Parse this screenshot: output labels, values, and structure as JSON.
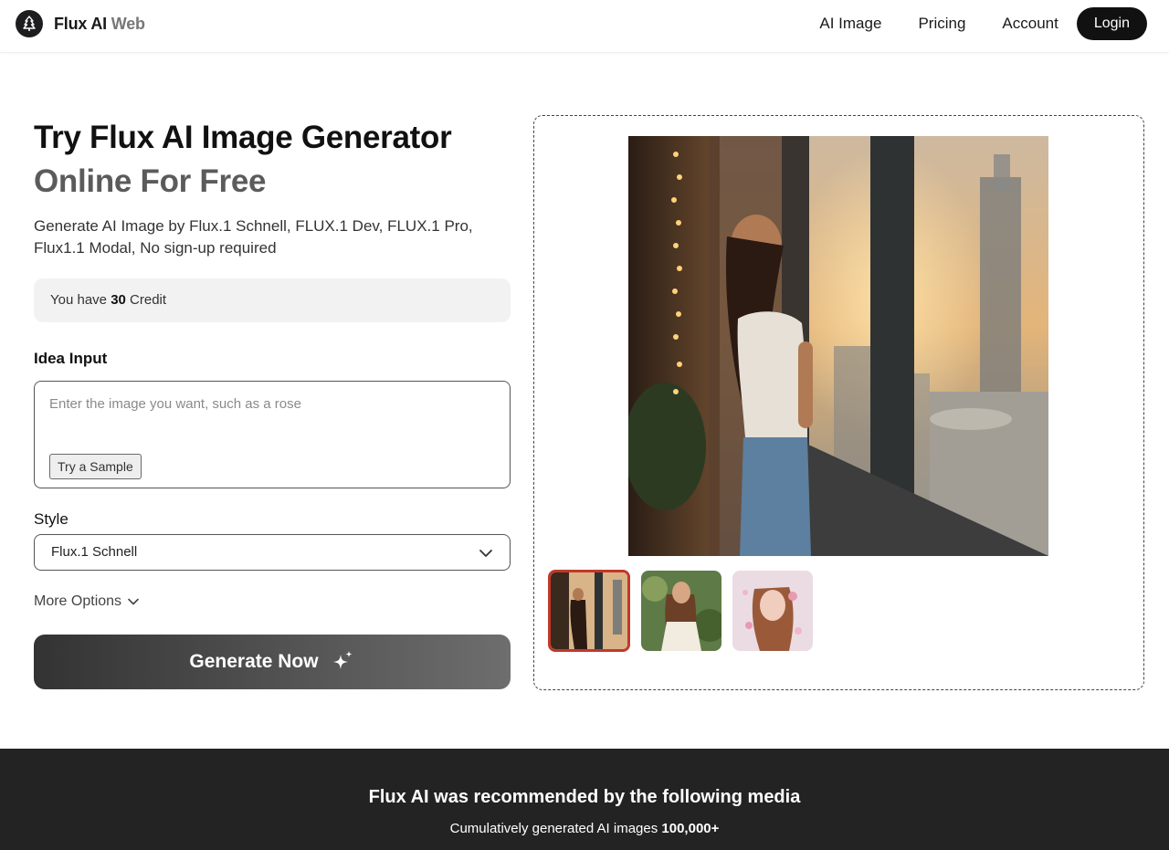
{
  "header": {
    "brand_main": "Flux AI",
    "brand_muted": "Web",
    "nav": [
      "AI Image",
      "Pricing",
      "Account"
    ],
    "login_label": "Login"
  },
  "hero": {
    "title_line1": "Try Flux AI Image Generator",
    "title_line2": "Online For Free",
    "subtitle": "Generate AI Image by Flux.1 Schnell, FLUX.1 Dev, FLUX.1 Pro, Flux1.1 Modal, No sign-up required"
  },
  "credit": {
    "prefix": "You have",
    "amount": "30",
    "suffix": "Credit"
  },
  "idea": {
    "label": "Idea Input",
    "placeholder": "Enter the image you want, such as a rose",
    "value": "",
    "sample_label": "Try a Sample"
  },
  "style": {
    "label": "Style",
    "selected": "Flux.1 Schnell"
  },
  "more_options_label": "More Options",
  "generate_label": "Generate Now",
  "gallery": {
    "selected_index": 0,
    "thumbnail_count": 3
  },
  "media_band": {
    "title": "Flux AI was recommended by the following media",
    "sub_prefix": "Cumulatively generated AI images",
    "sub_value": "100,000+"
  },
  "colors": {
    "accent_dark": "#111111",
    "thumb_selected_border": "#c0392b",
    "band_bg": "#232323"
  }
}
